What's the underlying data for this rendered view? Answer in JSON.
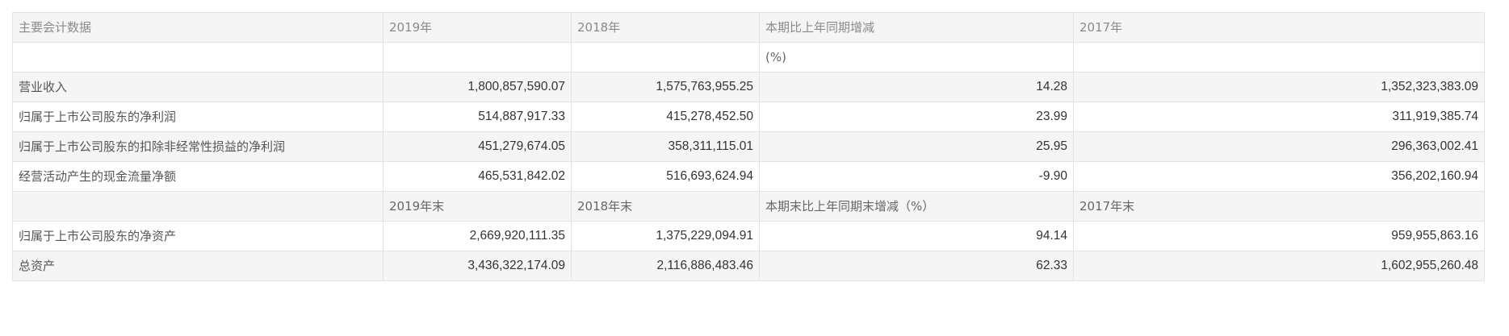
{
  "table": {
    "header": {
      "label": "主要会计数据",
      "y2019": "2019年",
      "y2018": "2018年",
      "change": "本期比上年同期增减",
      "y2017": "2017年"
    },
    "unit_row": {
      "change_unit": "(%)"
    },
    "rows_period": [
      {
        "label": "营业收入",
        "v2019": "1,800,857,590.07",
        "v2018": "1,575,763,955.25",
        "change": "14.28",
        "v2017": "1,352,323,383.09"
      },
      {
        "label": "归属于上市公司股东的净利润",
        "v2019": "514,887,917.33",
        "v2018": "415,278,452.50",
        "change": "23.99",
        "v2017": "311,919,385.74"
      },
      {
        "label": "归属于上市公司股东的扣除非经常性损益的净利润",
        "v2019": "451,279,674.05",
        "v2018": "358,311,115.01",
        "change": "25.95",
        "v2017": "296,363,002.41"
      },
      {
        "label": "经营活动产生的现金流量净额",
        "v2019": "465,531,842.02",
        "v2018": "516,693,624.94",
        "change": "-9.90",
        "v2017": "356,202,160.94"
      }
    ],
    "subheader": {
      "y2019": "2019年末",
      "y2018": "2018年末",
      "change": "本期末比上年同期末增减（%）",
      "y2017": "2017年末"
    },
    "rows_end": [
      {
        "label": "归属于上市公司股东的净资产",
        "v2019": "2,669,920,111.35",
        "v2018": "1,375,229,094.91",
        "change": "94.14",
        "v2017": "959,955,863.16"
      },
      {
        "label": "总资产",
        "v2019": "3,436,322,174.09",
        "v2018": "2,116,886,483.46",
        "change": "62.33",
        "v2017": "1,602,955,260.48"
      }
    ]
  }
}
